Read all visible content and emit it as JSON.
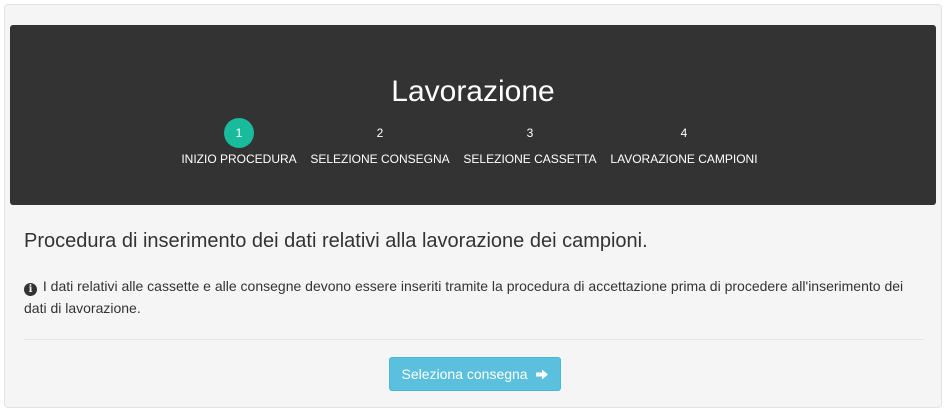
{
  "header": {
    "title": "Lavorazione",
    "steps": [
      {
        "number": "1",
        "label": "INIZIO PROCEDURA",
        "active": true
      },
      {
        "number": "2",
        "label": "SELEZIONE CONSEGNA",
        "active": false
      },
      {
        "number": "3",
        "label": "SELEZIONE CASSETTA",
        "active": false
      },
      {
        "number": "4",
        "label": "LAVORAZIONE CAMPIONI",
        "active": false
      }
    ]
  },
  "main": {
    "heading": "Procedura di inserimento dei dati relativi alla lavorazione dei campioni.",
    "info_icon": "info-circle-icon",
    "info_text": "I dati relativi alle cassette e alle consegne devono essere inseriti tramite la procedura di accettazione prima di procedere all'inserimento dei dati di lavorazione.",
    "button_label": "Seleziona consegna",
    "button_icon": "arrow-right-icon"
  },
  "colors": {
    "header_bg": "#333333",
    "active_step": "#18bc9c",
    "button_bg": "#5bc0de",
    "panel_bg": "#f5f5f5"
  }
}
